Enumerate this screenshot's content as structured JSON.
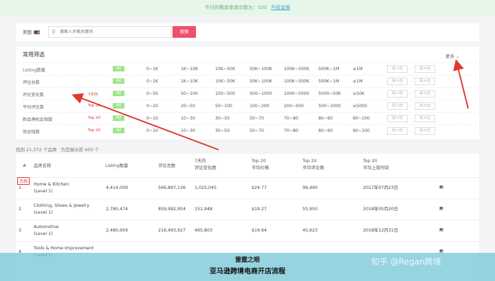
{
  "banner": {
    "text": "今日的剩余查询次数为：100",
    "link": "升级套餐"
  },
  "search": {
    "country": "美国",
    "placeholder": "搜索人员格关键词",
    "button": "搜索"
  },
  "filters": {
    "title": "常用筛选",
    "more": "更多",
    "min_placeholder": "最小值",
    "max_placeholder": "最大值",
    "rows": [
      {
        "label": "Listing数量",
        "select": "",
        "all": "All",
        "ranges": [
          "0~1K",
          "1K~10K",
          "10K~50K",
          "50K~100K",
          "100K~500K",
          "500K~1M",
          "≥1M"
        ]
      },
      {
        "label": "评论总数",
        "select": "",
        "all": "All",
        "ranges": [
          "0~1K",
          "1K~10K",
          "10K~50K",
          "50K~100K",
          "100K~500K",
          "500K~1M",
          "≥1M"
        ]
      },
      {
        "label": "评论变化数",
        "select": "7天内",
        "all": "All",
        "ranges": [
          "0~50",
          "50~100",
          "100~500",
          "500~1000",
          "1000~5000",
          "5000~50K",
          "≥50K"
        ]
      },
      {
        "label": "平均评论数",
        "select": "Top 20",
        "all": "All",
        "ranges": [
          "0~20",
          "20~50",
          "50~100",
          "100~200",
          "200~500",
          "500~1000",
          "≥5000"
        ]
      },
      {
        "label": "新品牌机会指数",
        "select": "Top 20",
        "all": "All",
        "ranges": [
          "0~10",
          "10~30",
          "30~50",
          "50~70",
          "70~80",
          "80~90",
          "90~100"
        ]
      },
      {
        "label": "货运指数",
        "select": "Top 20",
        "all": "All",
        "ranges": [
          "0~10",
          "10~30",
          "30~50",
          "50~70",
          "70~80",
          "80~90",
          "90~100"
        ]
      }
    ]
  },
  "results": {
    "count": "找到 21,372 个品类",
    "shown": "为您展示前 600 个"
  },
  "table": {
    "headers": {
      "idx": "#",
      "name": "品类名称",
      "listing": "Listing数量",
      "reviews": "评论总数",
      "change_1": "7天内",
      "change_2": "评论变化数",
      "price_1": "Top 20",
      "price_2": "平均价格",
      "avg_1": "Top 20",
      "avg_2": "平均评论数",
      "date_1": "Top 20",
      "date_2": "平均上架时间"
    },
    "sample_tag": "示例",
    "rows": [
      {
        "idx": "1",
        "name": "Home & Kitchen",
        "level": "(Level 1)",
        "listing": "4,414,009",
        "reviews": "566,897,136",
        "change": "1,025,045",
        "price": "$24.77",
        "avg": "99,490",
        "date": "2017年07月23日"
      },
      {
        "idx": "2",
        "name": "Clothing, Shoes & Jewelry",
        "level": "(Level 1)",
        "listing": "2,780,474",
        "reviews": "859,992,954",
        "change": "151,948",
        "price": "$19.27",
        "avg": "55,950",
        "date": "2018年05月20日"
      },
      {
        "idx": "3",
        "name": "Automotive",
        "level": "(Level 1)",
        "listing": "2,480,959",
        "reviews": "216,493,927",
        "change": "465,803",
        "price": "$19.64",
        "avg": "45,623",
        "date": "2018年12月31日"
      },
      {
        "idx": "4",
        "name": "Tools & Home Improvement",
        "level": "(Level 1)",
        "listing": "",
        "reviews": "",
        "change": "",
        "price": "",
        "avg": "",
        "date": ""
      }
    ]
  },
  "overlay": {
    "line1": "雷霆之眼",
    "line2": "亚马逊跨境电商开店流程",
    "watermark": "知乎 @Regan跨境"
  },
  "colors": {
    "accent": "#f0506e",
    "banner_bg": "#e6f6e9",
    "all_tag": "#9ee48c",
    "arrow": "#e03a2e"
  }
}
